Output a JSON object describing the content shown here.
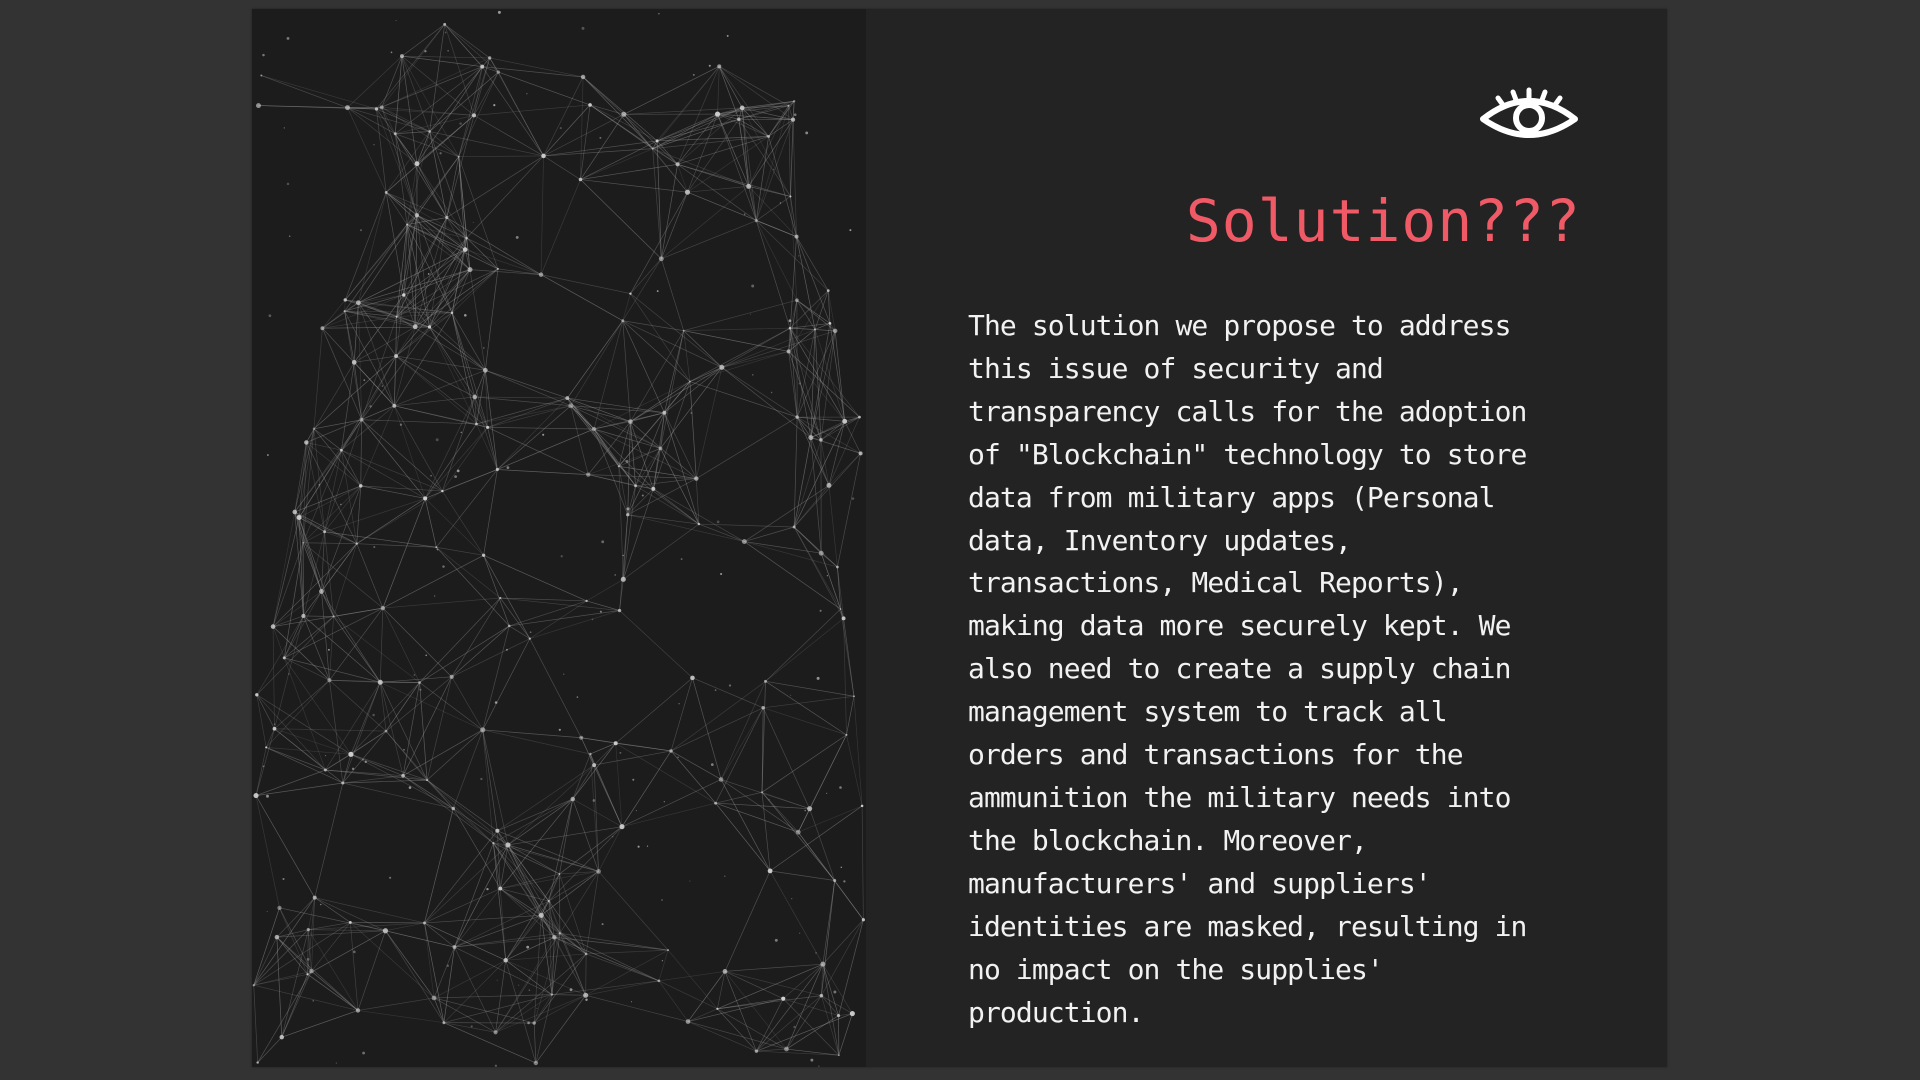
{
  "slide": {
    "title": "Solution???",
    "body": "The solution we propose to address\nthis issue of security and\ntransparency calls for the adoption\nof \"Blockchain\" technology to store\ndata from military apps (Personal\ndata, Inventory updates,\ntransactions, Medical Reports),\nmaking data more securely kept. We\nalso need to create a supply chain\nmanagement system to track all\norders and transactions for the\nammunition the military needs into\nthe blockchain. Moreover,\nmanufacturers' and suppliers'\nidentities are masked, resulting in\nno impact on the supplies'\nproduction.",
    "icon": "eye-icon",
    "image": "network-graph-image"
  },
  "colors": {
    "app_background": "#333333",
    "slide_background": "#232323",
    "title": "#f05a66",
    "body_text": "#f2f2f2",
    "network_lines": "#9a9a9a"
  }
}
